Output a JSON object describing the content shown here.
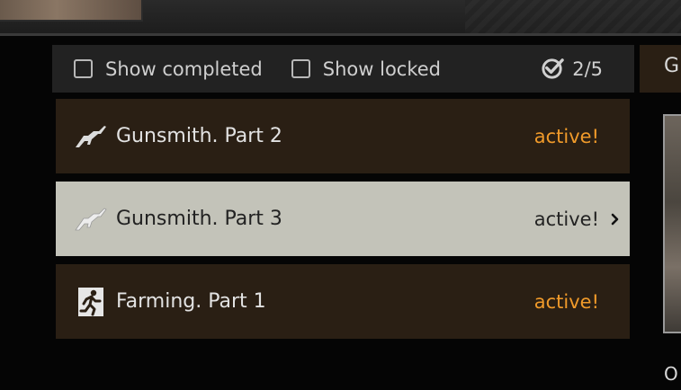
{
  "filters": {
    "show_completed_label": "Show completed",
    "show_locked_label": "Show locked",
    "show_completed_checked": false,
    "show_locked_checked": false,
    "progress_text": "2/5"
  },
  "quests": [
    {
      "name": "Gunsmith. Part 2",
      "status": "active!",
      "icon": "rifle-icon",
      "selected": false
    },
    {
      "name": "Gunsmith. Part 3",
      "status": "active!",
      "icon": "rifle-icon",
      "selected": true
    },
    {
      "name": "Farming. Part 1",
      "status": "active!",
      "icon": "running-man-icon",
      "selected": false
    }
  ],
  "right_panel": {
    "header_text": "G",
    "bottom_text": "O"
  },
  "colors": {
    "status_active": "#f09a2a",
    "row_background": "#2a1f14",
    "row_selected": "#c3c3b9",
    "filter_bar": "#222222"
  }
}
